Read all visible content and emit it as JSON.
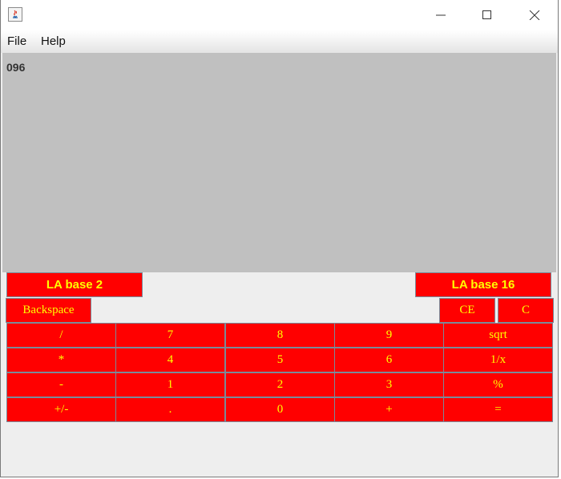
{
  "window": {
    "title": ""
  },
  "menubar": {
    "items": [
      "File",
      "Help"
    ]
  },
  "display": {
    "value": "096"
  },
  "mode_buttons": {
    "base2": "LA base 2",
    "base16": "LA base 16"
  },
  "edit_buttons": {
    "backspace": "Backspace",
    "ce": "CE",
    "c": "C"
  },
  "keypad": {
    "rows": [
      [
        "/",
        "7",
        "8",
        "9",
        "sqrt"
      ],
      [
        "*",
        "4",
        "5",
        "6",
        "1/x"
      ],
      [
        "-",
        "1",
        "2",
        "3",
        "%"
      ],
      [
        "+/-",
        ".",
        "0",
        "+",
        "="
      ]
    ]
  },
  "colors": {
    "button_bg": "#ff0000",
    "button_text": "#ffff00",
    "display_bg": "#c0c0c0",
    "window_bg": "#eeeeee"
  }
}
